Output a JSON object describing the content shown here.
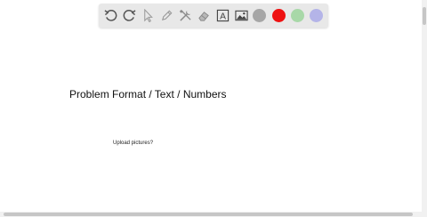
{
  "canvas": {
    "title": "Problem Format / Text / Numbers",
    "upload_label": "Upload pictures?"
  },
  "toolbar": {
    "tools": [
      "undo-icon",
      "redo-icon",
      "pointer-icon",
      "pencil-icon",
      "tools-icon",
      "eraser-icon",
      "text-box-icon",
      "image-icon"
    ],
    "text_tool_glyph": "A",
    "colors": {
      "gray": "#a6a6a6",
      "red": "#ee1111",
      "green": "#a8d8a8",
      "purple": "#b4b4e8"
    }
  }
}
